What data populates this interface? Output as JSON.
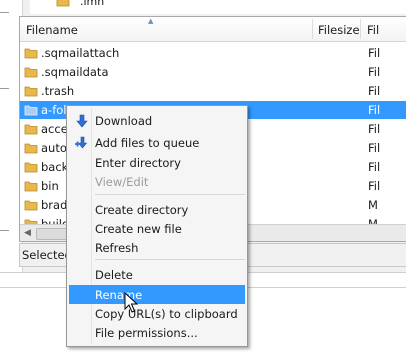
{
  "top_partial_item": {
    "label": ".imh"
  },
  "file_list": {
    "columns": [
      {
        "label": "Filename",
        "key": "filename"
      },
      {
        "label": "Filesize",
        "key": "filesize"
      },
      {
        "label": "Fil",
        "key": "filetype"
      }
    ],
    "rows": [
      {
        "name": ".sqmailattach",
        "type": "Fil",
        "selected": false
      },
      {
        "name": ".sqmaildata",
        "type": "Fil",
        "selected": false
      },
      {
        "name": ".trash",
        "type": "Fil",
        "selected": false
      },
      {
        "name": "a-fol",
        "type": "Fil",
        "selected": true
      },
      {
        "name": "acces",
        "type": "Fil",
        "selected": false
      },
      {
        "name": "autoc",
        "type": "Fil",
        "selected": false
      },
      {
        "name": "back",
        "type": "Fil",
        "selected": false
      },
      {
        "name": "bin",
        "type": "Fil",
        "selected": false
      },
      {
        "name": "bradr",
        "type": "M",
        "selected": false
      },
      {
        "name": "build",
        "type": "M",
        "selected": false
      }
    ],
    "status_text": "Selected"
  },
  "context_menu": {
    "items": [
      {
        "label": "Download",
        "icon": "download-arrow-icon",
        "disabled": false,
        "hover": false
      },
      {
        "label": "Add files to queue",
        "icon": "add-to-queue-icon",
        "disabled": false,
        "hover": false
      },
      {
        "label": "Enter directory",
        "icon": "",
        "disabled": false,
        "hover": false
      },
      {
        "label": "View/Edit",
        "icon": "",
        "disabled": true,
        "hover": false
      },
      {
        "label": "Create directory",
        "icon": "",
        "disabled": false,
        "hover": false
      },
      {
        "label": "Create new file",
        "icon": "",
        "disabled": false,
        "hover": false
      },
      {
        "label": "Refresh",
        "icon": "",
        "disabled": false,
        "hover": false
      },
      {
        "label": "Delete",
        "icon": "",
        "disabled": false,
        "hover": false
      },
      {
        "label": "Rename",
        "icon": "",
        "disabled": false,
        "hover": true
      },
      {
        "label": "Copy URL(s) to clipboard",
        "icon": "",
        "disabled": false,
        "hover": false
      },
      {
        "label": "File permissions...",
        "icon": "",
        "disabled": false,
        "hover": false
      }
    ]
  },
  "colors": {
    "selection": "#3399ff",
    "folder": "#e8b84a",
    "menu_background": "#f5f5f5",
    "download_arrow": "#2f6fd6"
  }
}
